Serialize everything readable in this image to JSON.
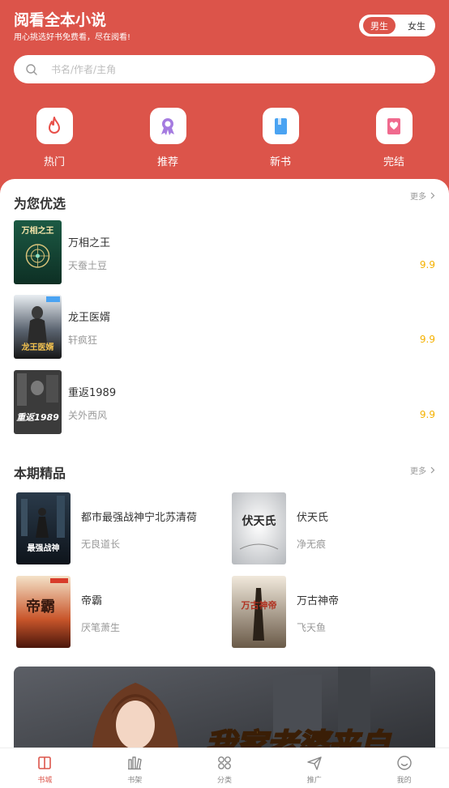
{
  "header": {
    "title": "阅看全本小说",
    "subtitle": "用心挑选好书免费看，尽在阅看!",
    "gender_options": [
      "男生",
      "女生"
    ],
    "gender_selected": "男生"
  },
  "search": {
    "placeholder": "书名/作者/主角",
    "value": ""
  },
  "quick_nav": [
    {
      "label": "热门",
      "icon": "flame-icon"
    },
    {
      "label": "推荐",
      "icon": "award-icon"
    },
    {
      "label": "新书",
      "icon": "book-icon"
    },
    {
      "label": "完结",
      "icon": "heart-book-icon"
    }
  ],
  "recommended": {
    "title": "为您优选",
    "more": "更多",
    "books": [
      {
        "title": "万相之王",
        "author": "天蚕土豆",
        "score": "9.9",
        "cover_text": "万相之王"
      },
      {
        "title": "龙王医婿",
        "author": "轩疯狂",
        "score": "9.9",
        "cover_text": "龙王医婿"
      },
      {
        "title": "重返1989",
        "author": "关外西风",
        "score": "9.9",
        "cover_text": "重返1989"
      }
    ]
  },
  "featured": {
    "title": "本期精品",
    "more": "更多",
    "books": [
      {
        "title": "都市最强战神宁北苏清荷",
        "author": "无良道长",
        "cover_text": "最强战神"
      },
      {
        "title": "伏天氏",
        "author": "净无痕",
        "cover_text": "伏天氏"
      },
      {
        "title": "帝霸",
        "author": "厌笔萧生",
        "cover_text": "帝霸"
      },
      {
        "title": "万古神帝",
        "author": "飞天鱼",
        "cover_text": "万古神帝"
      }
    ]
  },
  "banner": {
    "text": "我家老婆来自"
  },
  "tabbar": [
    {
      "label": "书城",
      "icon": "bookstore-icon",
      "active": true
    },
    {
      "label": "书架",
      "icon": "bookshelf-icon",
      "active": false
    },
    {
      "label": "分类",
      "icon": "category-icon",
      "active": false
    },
    {
      "label": "推广",
      "icon": "paper-plane-icon",
      "active": false
    },
    {
      "label": "我的",
      "icon": "smile-icon",
      "active": false
    }
  ],
  "colors": {
    "brand": "#dc544a",
    "score": "#f5b100"
  }
}
